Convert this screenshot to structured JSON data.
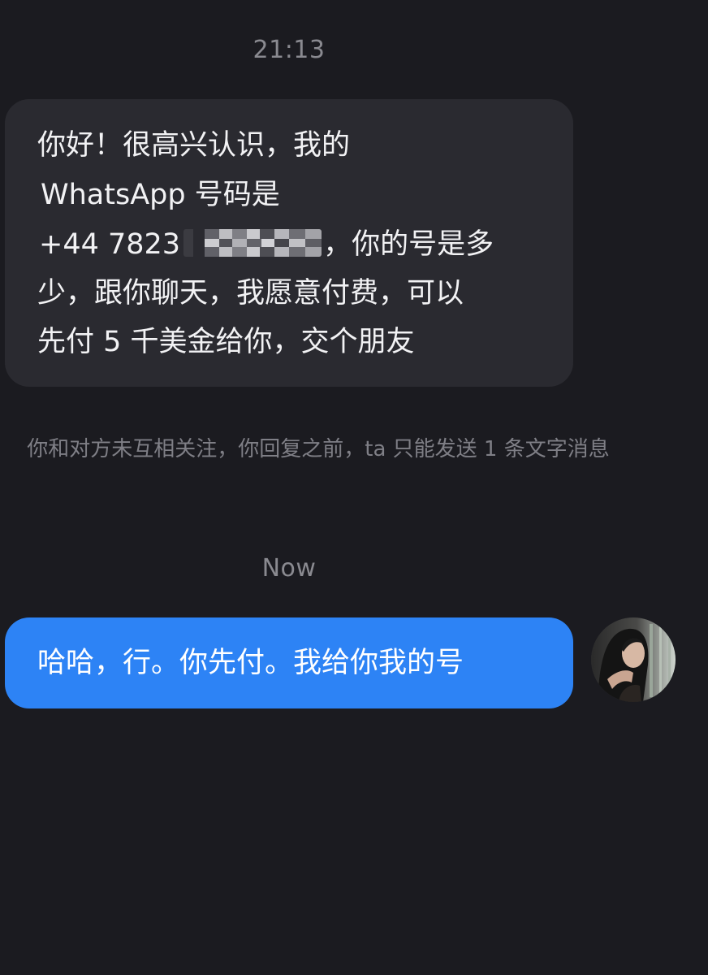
{
  "conversation": {
    "timestamp_top": "21:13",
    "incoming_message": {
      "line1": "你好！很高兴认识，我的",
      "line2": "WhatsApp 号码是",
      "line3_prefix": "+44 7823",
      "line3_suffix": "，你的号是多",
      "line4": "少，跟你聊天，我愿意付费，可以",
      "line5": "先付 5 千美金给你，交个朋友"
    },
    "system_notice": "你和对方未互相关注，你回复之前，ta 只能发送 1 条文字消息",
    "timestamp_now": "Now",
    "outgoing_message": "哈哈，行。你先付。我给你我的号"
  },
  "colors": {
    "background": "#1b1b20",
    "incoming_bubble": "#2a2a30",
    "outgoing_bubble": "#2d83f5",
    "muted_text": "#8a8a90"
  },
  "icons": {
    "avatar": "user-avatar-photo"
  }
}
